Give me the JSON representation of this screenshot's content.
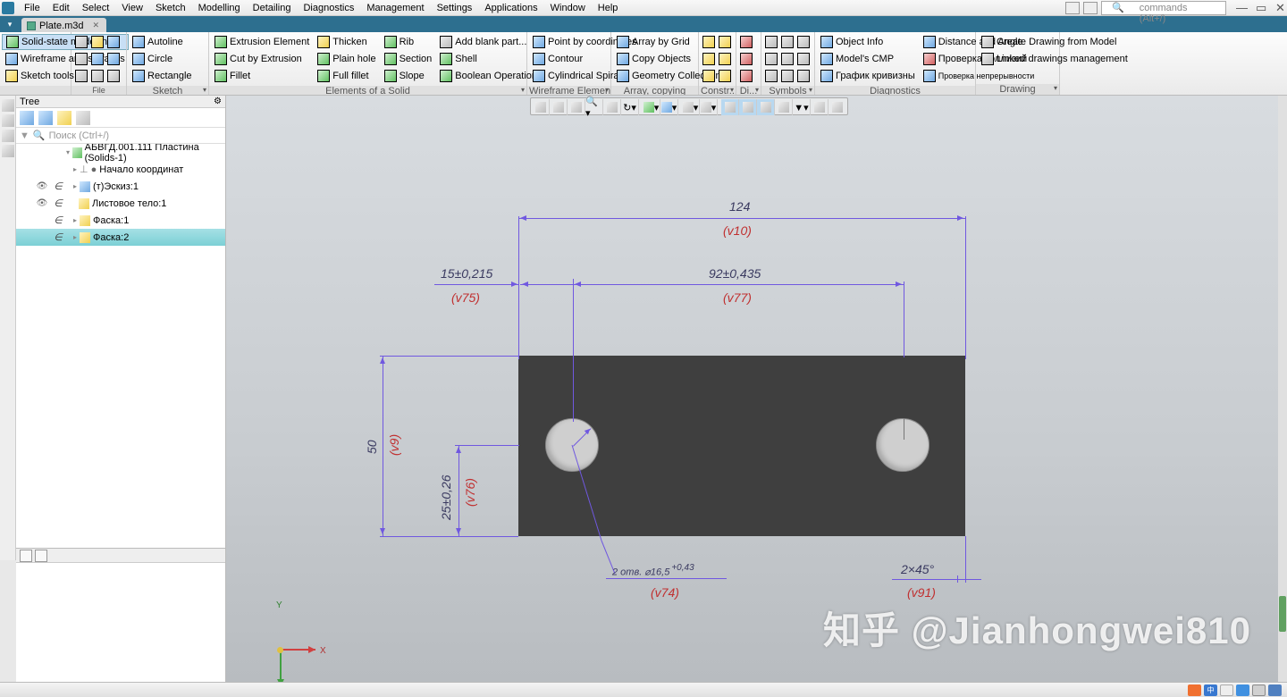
{
  "menu": [
    "File",
    "Edit",
    "Select",
    "View",
    "Sketch",
    "Modelling",
    "Detailing",
    "Diagnostics",
    "Management",
    "Settings",
    "Applications",
    "Window",
    "Help"
  ],
  "search_placeholder": "Search commands (Alt+/)",
  "tab": {
    "name": "Plate.m3d"
  },
  "ribbon": {
    "file": {
      "label": "File"
    },
    "sketch": {
      "label": "Sketch",
      "solid_state": "Solid-state modelling",
      "wireframe": "Wireframe and surfaces",
      "sketch_tools": "Sketch tools",
      "autoline": "Autoline",
      "circle": "Circle",
      "rectangle": "Rectangle"
    },
    "solid": {
      "label": "Elements of a Solid",
      "extrusion": "Extrusion Element",
      "cut": "Cut by Extrusion",
      "fillet": "Fillet",
      "thicken": "Thicken",
      "plainhole": "Plain hole",
      "fullfillet": "Full fillet",
      "rib": "Rib",
      "section": "Section",
      "slope": "Slope",
      "addblank": "Add blank part...",
      "shell": "Shell",
      "boolean": "Boolean Operation"
    },
    "wire": {
      "label": "Wireframe Elements",
      "pointby": "Point by coordinates",
      "contour": "Contour",
      "cylspiral": "Cylindrical Spiral"
    },
    "array": {
      "label": "Array, copying",
      "arraygrid": "Array by Grid",
      "copyobj": "Copy Objects",
      "geocol": "Geometry Collection"
    },
    "constr": {
      "label": "Constr..."
    },
    "di": {
      "label": "Di..."
    },
    "symbols": {
      "label": "Symbols"
    },
    "diag": {
      "label": "Diagnostics",
      "objinfo": "Object Info",
      "cmp": "Model's CMP",
      "kriv": "График кривизны",
      "distang": "Distance and Angle",
      "kollizii": "Проверка коллизий",
      "nepre": "Проверка непрерывности"
    },
    "drawing": {
      "label": "Drawing",
      "create": "Create Drawing from Model",
      "linked": "Linked drawings management"
    }
  },
  "tree": {
    "title": "Tree",
    "search_placeholder": "Поиск (Ctrl+/)",
    "root": "АБВГД.001.111 Пластина (Solids-1)",
    "items": [
      {
        "label": "Начало координат",
        "ico": "origin"
      },
      {
        "label": "(т)Эскиз:1",
        "ico": "sketch"
      },
      {
        "label": "Листовое тело:1",
        "ico": "sheet"
      },
      {
        "label": "Фаска:1",
        "ico": "chamfer"
      },
      {
        "label": "Фаска:2",
        "ico": "chamfer",
        "sel": true
      }
    ]
  },
  "dims": {
    "d124": "124",
    "v10": "(v10)",
    "d15": "15±0,215",
    "v75": "(v75)",
    "d92": "92±0,435",
    "v77": "(v77)",
    "d50": "50",
    "v9": "(v9)",
    "d25": "25±0,26",
    "v76": "(v76)",
    "hole": "2 отв. ⌀16,5",
    "hole_tol": "+0,43",
    "v74": "(v74)",
    "cham": "2×45°",
    "v91": "(v91)"
  },
  "axes": {
    "x": "X",
    "y": "Y"
  },
  "watermark": "知乎 @Jianhongwei810",
  "taskbar_cn": "中"
}
